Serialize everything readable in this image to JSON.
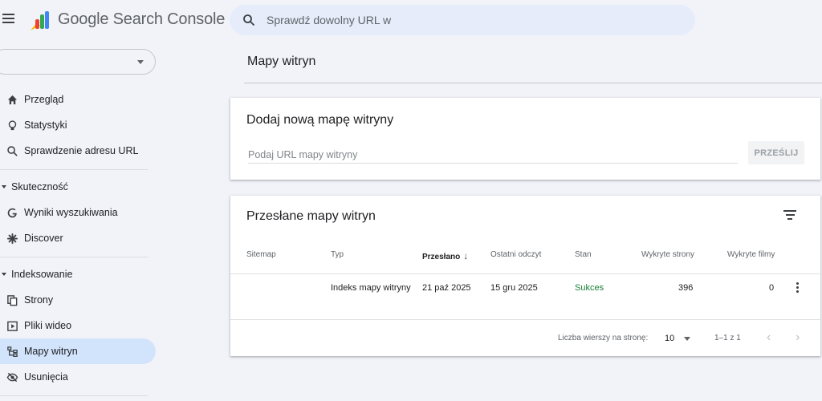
{
  "app": {
    "brand": "Google Search Console",
    "logo_colors": [
      "#fbbc04",
      "#ea4335",
      "#34a853",
      "#4285f4"
    ]
  },
  "search": {
    "placeholder": "Sprawdź dowolny URL w"
  },
  "property_selector": {
    "value": ""
  },
  "sidebar": {
    "top_items": [
      {
        "label": "Przegląd",
        "icon": "home-icon"
      },
      {
        "label": "Statystyki",
        "icon": "lightbulb-icon"
      },
      {
        "label": "Sprawdzenie adresu URL",
        "icon": "search-icon"
      }
    ],
    "sections": [
      {
        "title": "Skuteczność",
        "items": [
          {
            "label": "Wyniki wyszukiwania",
            "icon": "google-g-icon"
          },
          {
            "label": "Discover",
            "icon": "asterisk-icon"
          }
        ]
      },
      {
        "title": "Indeksowanie",
        "items": [
          {
            "label": "Strony",
            "icon": "pages-icon"
          },
          {
            "label": "Pliki wideo",
            "icon": "video-pages-icon"
          },
          {
            "label": "Mapy witryn",
            "icon": "sitemap-icon",
            "active": true
          },
          {
            "label": "Usunięcia",
            "icon": "eye-off-icon"
          }
        ]
      }
    ]
  },
  "page": {
    "title": "Mapy witryn"
  },
  "add_card": {
    "title": "Dodaj nową mapę witryny",
    "input_placeholder": "Podaj URL mapy witryny",
    "input_value": "",
    "submit_label": "PRZEŚLIJ"
  },
  "submitted_card": {
    "title": "Przesłane mapy witryn",
    "columns": [
      "Sitemap",
      "Typ",
      "Przesłano",
      "Ostatni odczyt",
      "Stan",
      "Wykryte strony",
      "Wykryte filmy"
    ],
    "sorted_column": "Przesłano",
    "sort_direction": "descending",
    "rows": [
      {
        "sitemap": "",
        "type": "Indeks mapy witryny",
        "submitted": "21 paź 2025",
        "last_read": "15 gru 2025",
        "status": "Sukces",
        "discovered_pages": "396",
        "discovered_videos": "0"
      }
    ],
    "footer": {
      "rows_per_page_label": "Liczba wierszy na stronę:",
      "rows_per_page_value": "10",
      "range": "1–1 z 1"
    },
    "status_color": "#188038"
  },
  "colors": {
    "active_nav": "#d2e3fc",
    "search_bg": "#e6ecfa",
    "page_bg": "#f1f3f9"
  }
}
